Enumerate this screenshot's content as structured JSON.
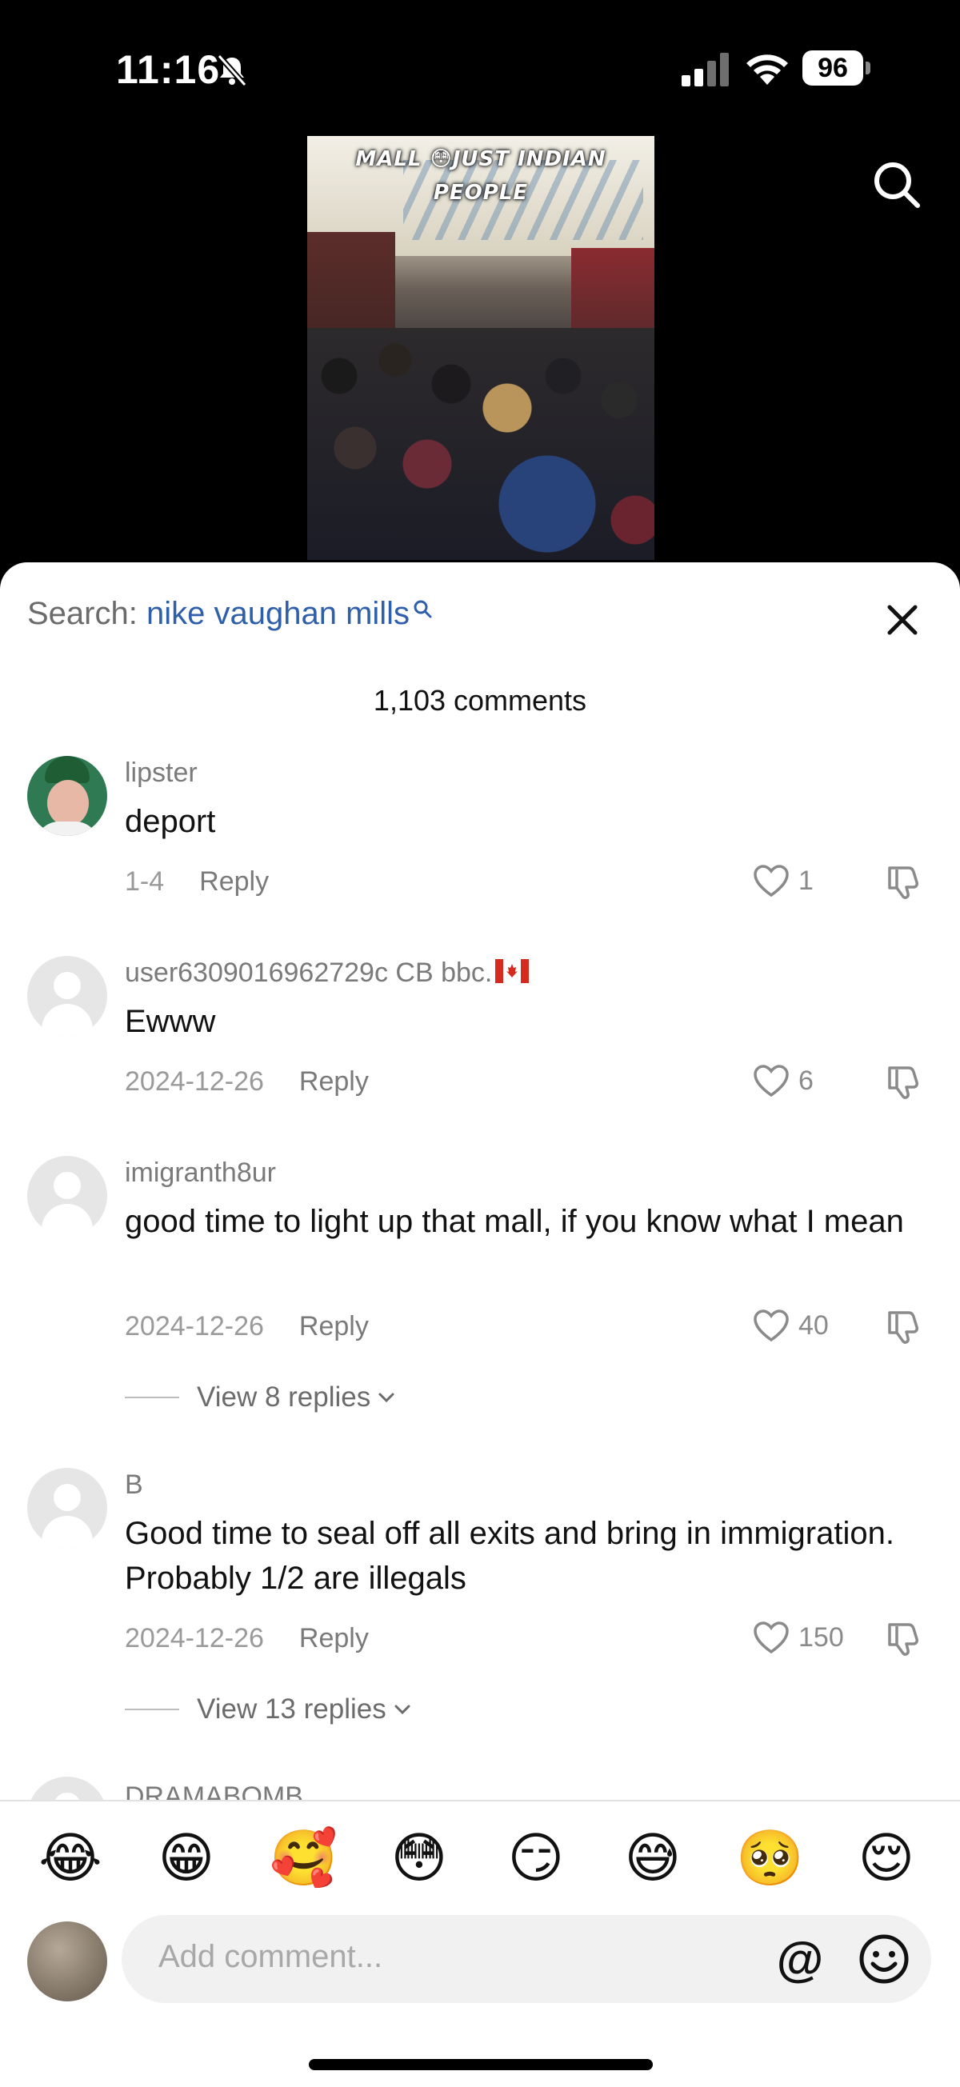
{
  "status_bar": {
    "time": "11:16",
    "battery": "96",
    "icons": [
      "bell-slash-icon",
      "cellular-signal-icon",
      "wifi-icon",
      "battery-icon"
    ]
  },
  "video": {
    "caption_line1": "MALL 😳JUST INDIAN",
    "caption_line2": "PEOPLE"
  },
  "sheet": {
    "search_prefix": "Search:",
    "search_query": "nike vaughan mills",
    "comment_count": "1,103 comments"
  },
  "comments": [
    {
      "username": "lipster",
      "text": "deport",
      "date": "1-4",
      "reply_label": "Reply",
      "likes": "1"
    },
    {
      "username": "user6309016962729c CB bbc.",
      "text": "Ewww",
      "date": "2024-12-26",
      "reply_label": "Reply",
      "likes": "6"
    },
    {
      "username": "imigranth8ur",
      "text": "good time to light up that mall, if you know what I mean",
      "date": "2024-12-26",
      "reply_label": "Reply",
      "likes": "40",
      "view_replies": "View 8 replies"
    },
    {
      "username": "B",
      "text": "Good time to seal off all exits and bring in immigration. Probably 1/2 are illegals",
      "date": "2024-12-26",
      "reply_label": "Reply",
      "likes": "150",
      "view_replies": "View 13 replies"
    },
    {
      "username": "DRAMABOMB"
    }
  ],
  "emoji_bar": [
    "😂",
    "😁",
    "🥰",
    "😳",
    "😏",
    "😅",
    "🥺",
    "😌"
  ],
  "composer": {
    "placeholder": "Add comment...",
    "at_symbol": "@"
  }
}
